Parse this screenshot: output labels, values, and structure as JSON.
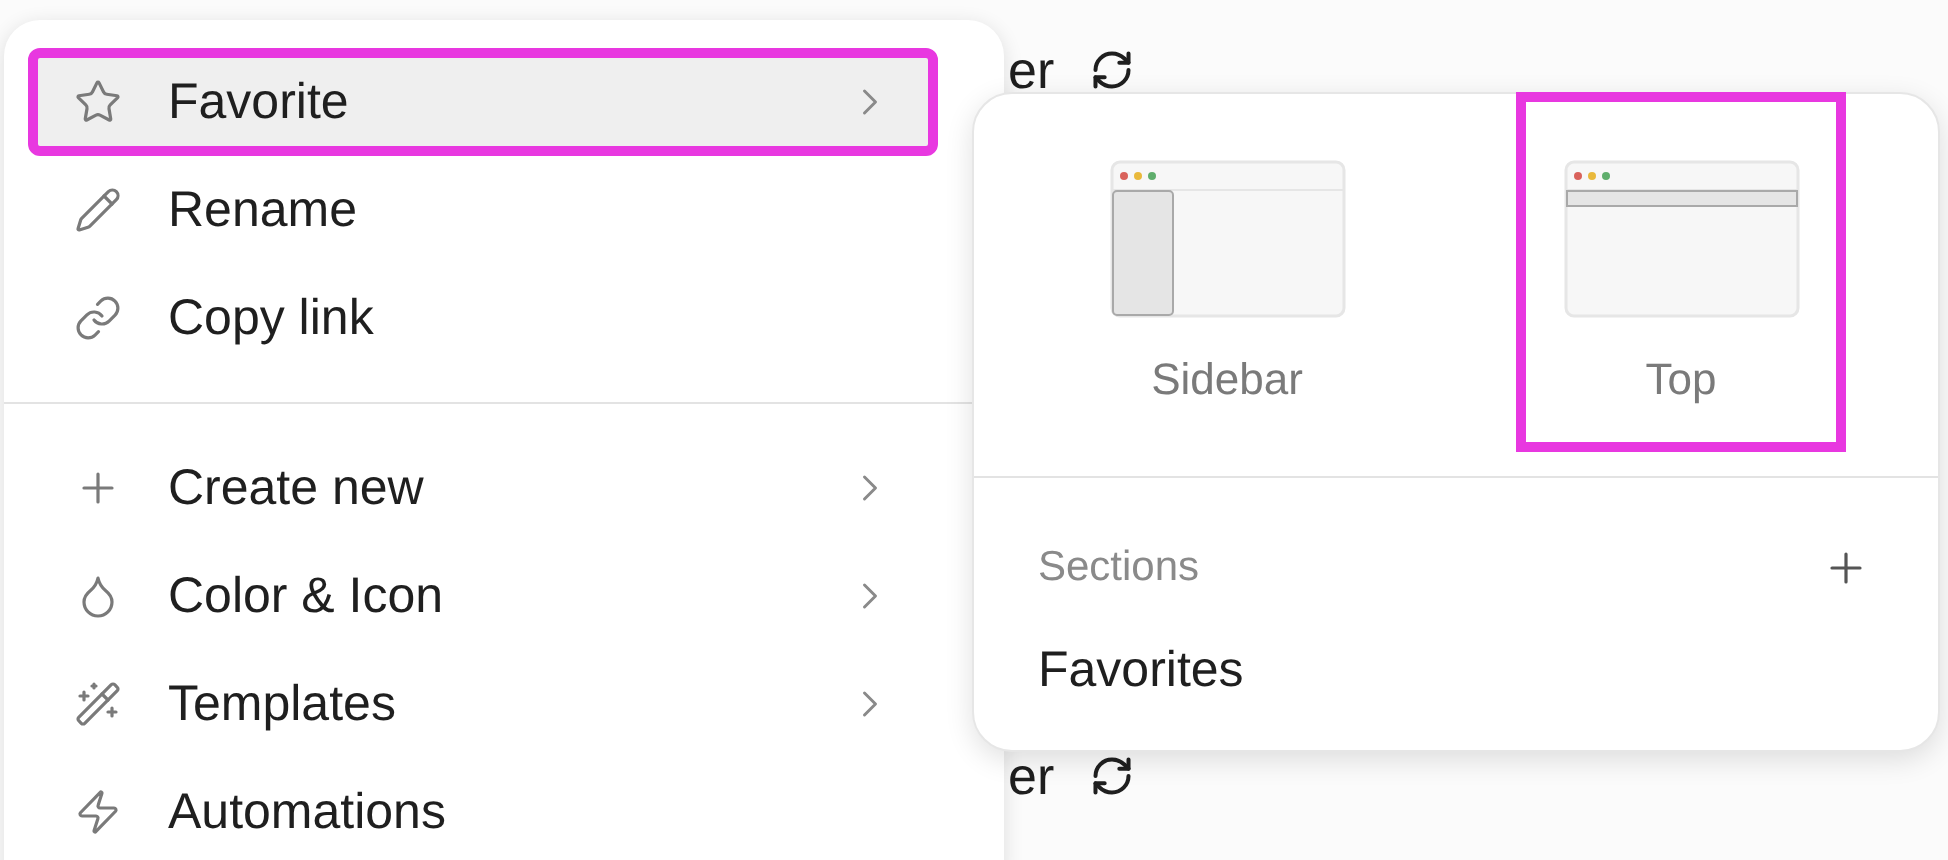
{
  "background": {
    "rows": [
      {
        "text": "er"
      },
      {
        "text": "er"
      }
    ]
  },
  "menu": {
    "groups": [
      [
        {
          "label": "Favorite",
          "kind": "star",
          "submenu": true,
          "hovered": true,
          "highlighted": true
        },
        {
          "label": "Rename",
          "kind": "pencil",
          "submenu": false,
          "hovered": false,
          "highlighted": false
        },
        {
          "label": "Copy link",
          "kind": "link",
          "submenu": false,
          "hovered": false,
          "highlighted": false
        }
      ],
      [
        {
          "label": "Create new",
          "kind": "plus",
          "submenu": true,
          "hovered": false,
          "highlighted": false
        },
        {
          "label": "Color & Icon",
          "kind": "droplet",
          "submenu": true,
          "hovered": false,
          "highlighted": false
        },
        {
          "label": "Templates",
          "kind": "wand",
          "submenu": true,
          "hovered": false,
          "highlighted": false
        },
        {
          "label": "Automations",
          "kind": "zap",
          "submenu": false,
          "hovered": false,
          "highlighted": false
        }
      ]
    ]
  },
  "submenu": {
    "layouts": [
      {
        "label": "Sidebar",
        "kind": "sidebar",
        "highlighted": false
      },
      {
        "label": "Top",
        "kind": "top",
        "highlighted": true
      }
    ],
    "sections": {
      "title": "Sections",
      "items": [
        {
          "label": "Favorites"
        }
      ]
    }
  }
}
